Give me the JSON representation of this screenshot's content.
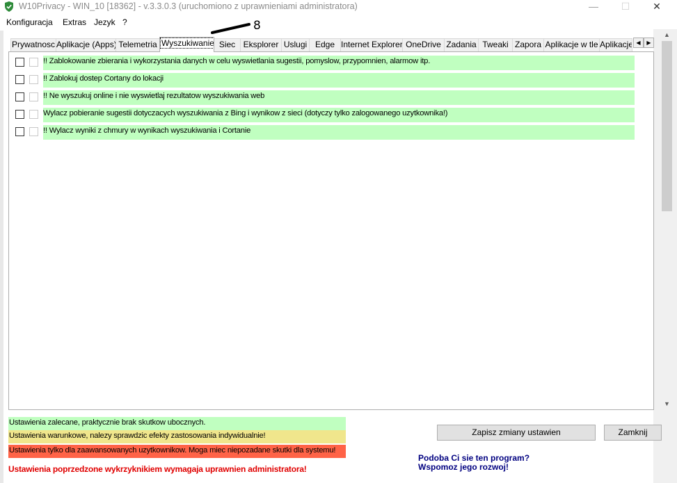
{
  "window": {
    "title": "W10Privacy - WIN_10 [18362]  - v.3.3.0.3 (uruchomiono z uprawnieniami administratora)",
    "minimize": "—",
    "maximize": "☐",
    "close": "✕"
  },
  "menu": [
    "Konfiguracja",
    "Extras",
    "Jezyk",
    "?"
  ],
  "annotation_number": "8",
  "tabs": [
    "Prywatnosc",
    "Aplikacje (Apps)",
    "Telemetria",
    "Wyszukiwanie",
    "Siec",
    "Eksplorer",
    "Uslugi",
    "Edge",
    "Internet Explorer",
    "OneDrive",
    "Zadania",
    "Tweaki",
    "Zapora",
    "Aplikacje w tle",
    "Aplikacje"
  ],
  "active_tab": "Wyszukiwanie",
  "settings": [
    {
      "label": "!! Zablokowanie zbierania i wykorzystania danych w celu wyswietlania sugestii, pomyslow, przypomnien, alarmow itp.",
      "checked": false,
      "level": "recommended"
    },
    {
      "label": "!! Zablokuj dostep Cortany do lokacji",
      "checked": false,
      "level": "recommended"
    },
    {
      "label": "!! Ne wyszukuj online i nie wyswietlaj rezultatow wyszukiwania web",
      "checked": false,
      "level": "recommended"
    },
    {
      "label": "Wylacz pobieranie sugestii dotyczacych wyszukiwania z Bing i wynikow  z sieci (dotyczy tylko zalogowanego uzytkownika!)",
      "checked": false,
      "level": "recommended"
    },
    {
      "label": "!! Wylacz wyniki z chmury w wynikach wyszukiwania i Cortanie",
      "checked": false,
      "level": "recommended"
    }
  ],
  "legend": {
    "green": "Ustawienia zalecane, praktycznie brak skutkow ubocznych.",
    "yellow": "Ustawienia warunkowe, nalezy sprawdzic efekty zastosowania indywidualnie!",
    "red": "Ustawienia tylko dla zaawansowanych uzytkownikow. Moga miec niepozadane skutki dla systemu!"
  },
  "admin_note": "Ustawienia poprzedzone wykrzyknikiem wymagaja uprawnien administratora!",
  "buttons": {
    "save": "Zapisz zmiany ustawien",
    "close": "Zamknij"
  },
  "support": {
    "line1": "Podoba Ci sie ten program?",
    "line2": "Wspomoz jego rozwoj!"
  },
  "colors": {
    "recommended": "#c0ffc0",
    "conditional": "#f0e68c",
    "advanced": "#ff6347",
    "admin_note": "#e00000",
    "support_link": "#000080"
  }
}
